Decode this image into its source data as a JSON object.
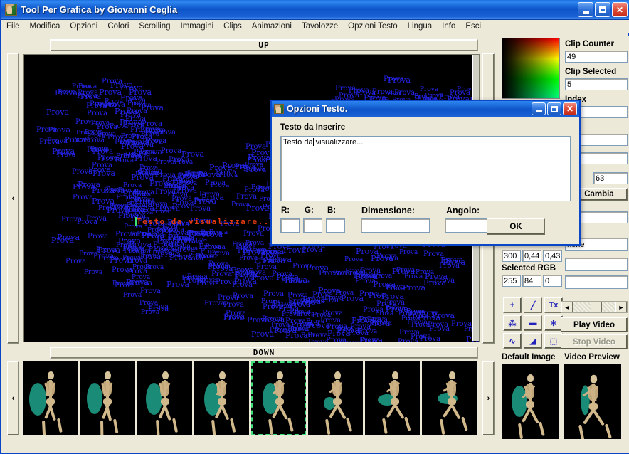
{
  "window": {
    "title": "Tool Per Grafica by Giovanni Ceglia",
    "minimize_label": "minimize",
    "maximize_label": "maximize",
    "close_label": "close"
  },
  "menu": {
    "items": [
      "File",
      "Modifica",
      "Opzioni",
      "Colori",
      "Scrolling",
      "Immagini",
      "Clips",
      "Animazioni",
      "Tavolozze",
      "Opzioni Testo",
      "Lingua",
      "Info",
      "Esci"
    ]
  },
  "canvas": {
    "up_label": "UP",
    "down_label": "DOWN",
    "left_arrow": "‹",
    "right_arrow": "›",
    "strip_left_arrow": "‹",
    "strip_right_arrow": "›",
    "overlay_text": "Testo da visualizzare...",
    "overlay_text_color": "#e03a10",
    "scatter_word": "Prova",
    "scatter_color": "#2424f0",
    "background_color": "#000000"
  },
  "filmstrip": {
    "selected_index": 4,
    "frame_count": 8,
    "selection_color": "#3ee07a"
  },
  "sidebar": {
    "color_picker_name": "color-gradient-picker",
    "fields": [
      {
        "label": "Clip Counter",
        "value": "49"
      },
      {
        "label": "Clip Selected",
        "value": "5"
      },
      {
        "label": "Index",
        "value": ""
      },
      {
        "label": "",
        "value": ""
      },
      {
        "label": "",
        "value": ""
      }
    ],
    "palette_index_value": "63",
    "cambia_label": "Cambia",
    "hsv_label": "HSV",
    "hsv": [
      "300",
      "0,44",
      "0,43"
    ],
    "selected_rgb_label": "Selected RGB",
    "rgb": [
      "255",
      "84",
      "0"
    ],
    "none_value": "none",
    "extra_values": [
      "",
      "",
      ""
    ],
    "tools": [
      {
        "name": "crosshair-tool",
        "glyph": "+"
      },
      {
        "name": "pencil-tool",
        "glyph": "╱"
      },
      {
        "name": "text-tool",
        "glyph": "Tx"
      },
      {
        "name": "spray-tool",
        "glyph": "⁂"
      },
      {
        "name": "eraser-tool",
        "glyph": "▬"
      },
      {
        "name": "blob-tool",
        "glyph": "✻"
      },
      {
        "name": "curve-tool",
        "glyph": "∿"
      },
      {
        "name": "fill-bucket-tool",
        "glyph": "◢"
      },
      {
        "name": "select-rect-tool",
        "glyph": "⬚"
      }
    ],
    "play_video_label": "Play Video",
    "stop_video_label": "Stop Video",
    "default_image_label": "Default Image",
    "video_preview_label": "Video Preview",
    "scroll_left": "◄",
    "scroll_right": "►"
  },
  "dialog": {
    "title": "Opzioni Testo.",
    "text_label": "Testo da Inserire",
    "textarea_value": "Testo da visualizzare...",
    "textarea_caret_after": 8,
    "r_label": "R:",
    "g_label": "G:",
    "b_label": "B:",
    "dimensione_label": "Dimensione:",
    "angolo_label": "Angolo:",
    "r_value": "",
    "g_value": "",
    "b_value": "",
    "dimensione_value": "",
    "angolo_value": "",
    "ok_label": "OK",
    "minimize_label": "minimize",
    "maximize_label": "maximize",
    "close_label": "close"
  }
}
